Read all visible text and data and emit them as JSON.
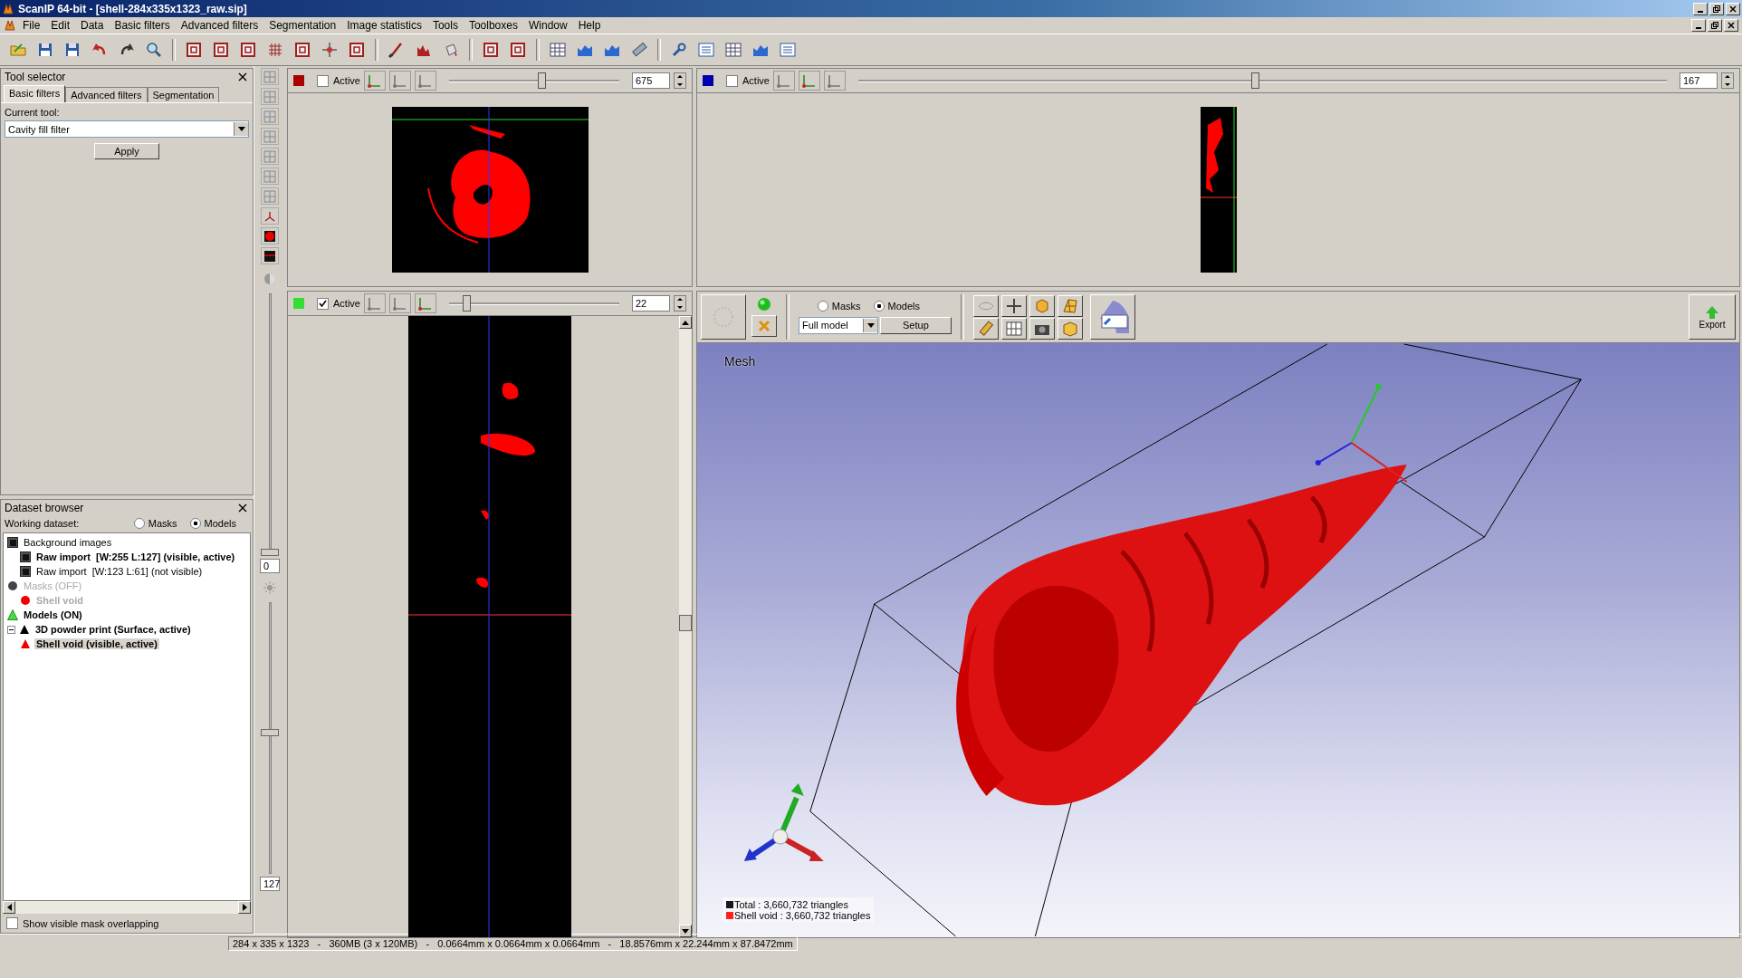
{
  "window": {
    "title": "ScanIP 64-bit - [shell-284x335x1323_raw.sip]"
  },
  "menu": [
    "File",
    "Edit",
    "Data",
    "Basic filters",
    "Advanced filters",
    "Segmentation",
    "Image statistics",
    "Tools",
    "Toolboxes",
    "Window",
    "Help"
  ],
  "tool_selector": {
    "title": "Tool selector",
    "tabs": [
      {
        "label": "Basic filters",
        "selected": true
      },
      {
        "label": "Advanced filters",
        "selected": false
      },
      {
        "label": "Segmentation",
        "selected": false
      }
    ],
    "current_tool_label": "Current tool:",
    "current_tool": "Cavity fill filter",
    "apply": "Apply"
  },
  "dataset_browser": {
    "title": "Dataset browser",
    "working_label": "Working dataset:",
    "options": [
      {
        "label": "Masks",
        "selected": false
      },
      {
        "label": "Models",
        "selected": true
      }
    ],
    "tree": [
      {
        "label": "Background images",
        "kind": "image",
        "bold": false,
        "disabled": false,
        "selected": false,
        "children": [
          {
            "label": "Raw import  [W:255 L:127] (visible, active)",
            "kind": "image",
            "bold": true,
            "disabled": false,
            "selected": false
          },
          {
            "label": "Raw import  [W:123 L:61] (not visible)",
            "kind": "image",
            "bold": false,
            "disabled": false,
            "selected": false
          }
        ]
      },
      {
        "label": "Masks (OFF)",
        "kind": "mask-group",
        "bold": false,
        "disabled": true,
        "selected": false,
        "children": [
          {
            "label": "Shell void",
            "kind": "mask",
            "bold": true,
            "disabled": true,
            "selected": false
          }
        ]
      },
      {
        "label": "Models (ON)",
        "kind": "model-group",
        "bold": true,
        "disabled": false,
        "selected": false
      },
      {
        "label": "3D powder print (Surface, active)",
        "kind": "model",
        "bold": true,
        "disabled": false,
        "selected": false,
        "expanded": true,
        "children": [
          {
            "label": "Shell void (visible, active)",
            "kind": "model-item",
            "bold": true,
            "disabled": false,
            "selected": true
          }
        ]
      }
    ],
    "show_overlap": {
      "label": "Show visible mask overlapping",
      "checked": false
    }
  },
  "side_strip": {
    "sliders": [
      {
        "level": 0,
        "value": "0"
      },
      {
        "level": 0.52,
        "value": "127"
      }
    ]
  },
  "views": [
    {
      "color": "#aa0000",
      "label": "Active",
      "active": false,
      "level": 0.54,
      "value": "675"
    },
    {
      "color": "#0000aa",
      "label": "Active",
      "active": false,
      "level": 0.49,
      "value": "167"
    },
    {
      "color": "#33dd33",
      "label": "Active",
      "active": true,
      "level": 0.1,
      "value": "22"
    }
  ],
  "view3d": {
    "options": [
      {
        "label": "Masks",
        "selected": false
      },
      {
        "label": "Models",
        "selected": true
      }
    ],
    "mode": "Full model",
    "setup": "Setup",
    "export": "Export",
    "title": "Mesh",
    "legend": [
      {
        "text": "Total : 3,660,732 triangles",
        "color": "#1a1a1a"
      },
      {
        "text": "Shell void : 3,660,732 triangles",
        "color": "#ff2020"
      }
    ]
  },
  "status_bar": "284 x 335 x 1323   -   360MB (3 x 120MB)   -   0.0664mm x 0.0664mm x 0.0664mm   -   18.8576mm x 22.244mm x 87.8472mm"
}
